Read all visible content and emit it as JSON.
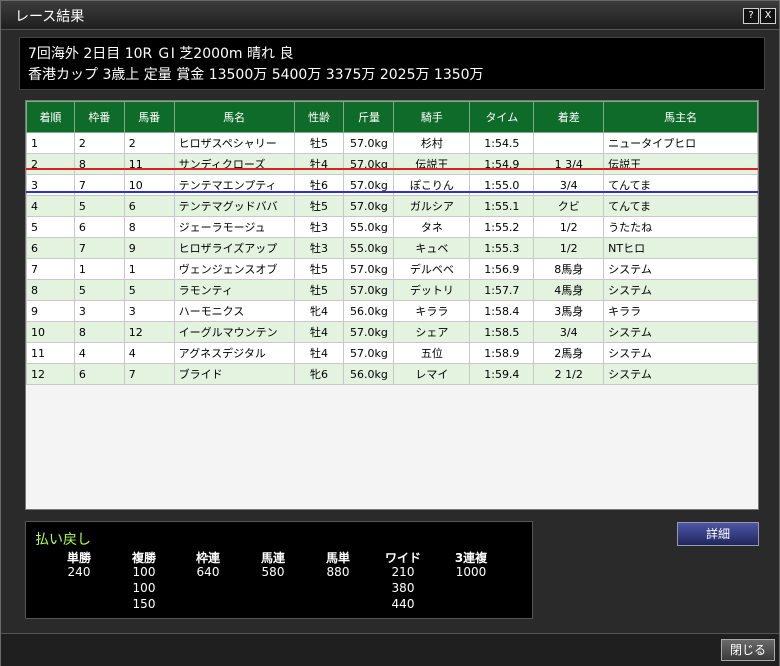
{
  "window": {
    "title": "レース結果",
    "help": "?",
    "close": "X"
  },
  "race": {
    "line1": "7回海外 2日目 10R ＧⅠ 芝2000m 晴れ 良",
    "line2": "香港カップ 3歳上 定量 賞金 13500万 5400万 3375万 2025万 1350万"
  },
  "table": {
    "headers": [
      "着順",
      "枠番",
      "馬番",
      "馬名",
      "性齢",
      "斤量",
      "騎手",
      "タイム",
      "着差",
      "馬主名"
    ],
    "rows": [
      [
        "1",
        "2",
        "2",
        "ヒロザスペシャリー",
        "牡5",
        "57.0kg",
        "杉村",
        "1:54.5",
        "",
        "ニュータイプヒロ"
      ],
      [
        "2",
        "8",
        "11",
        "サンディクローズ",
        "牡4",
        "57.0kg",
        "伝説王",
        "1:54.9",
        "1 3/4",
        "伝説王"
      ],
      [
        "3",
        "7",
        "10",
        "テンテマエンプティ",
        "牡6",
        "57.0kg",
        "ぽこりん",
        "1:55.0",
        "3/4",
        "てんてま"
      ],
      [
        "4",
        "5",
        "6",
        "テンテマグッドババ",
        "牡5",
        "57.0kg",
        "ガルシア",
        "1:55.1",
        "クビ",
        "てんてま"
      ],
      [
        "5",
        "6",
        "8",
        "ジェーラモージュ",
        "牡3",
        "55.0kg",
        "タネ",
        "1:55.2",
        "1/2",
        "うたたね"
      ],
      [
        "6",
        "7",
        "9",
        "ヒロザライズアップ",
        "牡3",
        "55.0kg",
        "キュベ",
        "1:55.3",
        "1/2",
        "NTヒロ"
      ],
      [
        "7",
        "1",
        "1",
        "ヴェンジェンスオブ",
        "牡5",
        "57.0kg",
        "デルベベ",
        "1:56.9",
        "8馬身",
        "システム"
      ],
      [
        "8",
        "5",
        "5",
        "ラモンティ",
        "牡5",
        "57.0kg",
        "デットリ",
        "1:57.7",
        "4馬身",
        "システム"
      ],
      [
        "9",
        "3",
        "3",
        "ハーモニクス",
        "牝4",
        "56.0kg",
        "キララ",
        "1:58.4",
        "3馬身",
        "キララ"
      ],
      [
        "10",
        "8",
        "12",
        "イーグルマウンテン",
        "牡4",
        "57.0kg",
        "シェア",
        "1:58.5",
        "3/4",
        "システム"
      ],
      [
        "11",
        "4",
        "4",
        "アグネスデジタル",
        "牡4",
        "57.0kg",
        "五位",
        "1:58.9",
        "2馬身",
        "システム"
      ],
      [
        "12",
        "6",
        "7",
        "ブライド",
        "牝6",
        "56.0kg",
        "レマイ",
        "1:59.4",
        "2 1/2",
        "システム"
      ]
    ]
  },
  "payout": {
    "title": "払い戻し",
    "columns": [
      {
        "label": "単勝",
        "values": [
          "240"
        ]
      },
      {
        "label": "複勝",
        "values": [
          "100",
          "100",
          "150"
        ]
      },
      {
        "label": "枠連",
        "values": [
          "640"
        ]
      },
      {
        "label": "馬連",
        "values": [
          "580"
        ]
      },
      {
        "label": "馬単",
        "values": [
          "880"
        ]
      },
      {
        "label": "ワイド",
        "values": [
          "210",
          "380",
          "440"
        ]
      },
      {
        "label": "3連複",
        "values": [
          "1000"
        ]
      }
    ]
  },
  "buttons": {
    "detail": "詳細",
    "close": "閉じる"
  }
}
